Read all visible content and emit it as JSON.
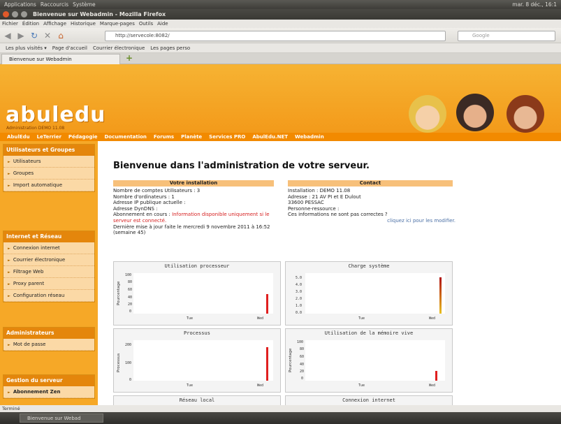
{
  "desktop": {
    "menus": [
      "Applications",
      "Raccourcis",
      "Système"
    ],
    "clock": "mar. 8 déc., 16:1"
  },
  "window": {
    "title": "Bienvenue sur Webadmin - Mozilla Firefox"
  },
  "firefox_menu": [
    "Fichier",
    "Édition",
    "Affichage",
    "Historique",
    "Marque-pages",
    "Outils",
    "Aide"
  ],
  "nav": {
    "url": "http://servecole:8082/",
    "search_placeholder": "Google"
  },
  "bookmarks": [
    "Les plus visités ▾",
    "Page d'accueil",
    "Courrier électronique",
    "Les pages perso"
  ],
  "tab": {
    "label": "Bienvenue sur Webadmin"
  },
  "site": {
    "logo": "abuledu",
    "logo_sub": "Administration DEMO 11.08",
    "top_links": [
      "AbulEdu",
      "LeTerrier",
      "Pédagogie",
      "Documentation",
      "Forums",
      "Planète",
      "Services PRO",
      "AbulEdu.NET",
      "Webadmin"
    ]
  },
  "sidebar": {
    "sections": [
      {
        "title": "Utilisateurs et Groupes",
        "items": [
          "Utilisateurs",
          "Groupes",
          "Import automatique"
        ]
      },
      {
        "title": "Internet et Réseau",
        "items": [
          "Connexion internet",
          "Courrier électronique",
          "Filtrage Web",
          "Proxy parent",
          "Configuration réseau"
        ]
      },
      {
        "title": "Administrateurs",
        "items": [
          "Mot de passe"
        ]
      },
      {
        "title": "Gestion du serveur",
        "items": [
          "Abonnement Zen"
        ]
      }
    ]
  },
  "main": {
    "heading": "Bienvenue dans l'administration de votre serveur.",
    "install": {
      "header": "Votre installation",
      "lines": [
        "Nombre de comptes Utilisateurs : 3",
        "Nombre d'ordinateurs : 1",
        "Adresse IP publique actuelle :",
        "Adresse DynDNS :"
      ],
      "subscription_label": "Abonnement en cours : ",
      "subscription_value": "Information disponible uniquement si le serveur est connecté.",
      "update": "Dernière mise à jour faite le mercredi 9 novembre 2011 à 16:52 (semaine 45)"
    },
    "contact": {
      "header": "Contact",
      "lines": [
        "Installation : DEMO 11.08",
        "Adresse : 21 AV PI et E Dulout",
        "33600 PESSAC",
        "Personne-ressource :",
        "Ces informations ne sont pas correctes ?"
      ],
      "link": "cliquez ici pour les modifier."
    }
  },
  "charts": [
    {
      "title": "Utilisation processeur",
      "ylabel": "Pourcentage",
      "yticks": [
        "100",
        "80",
        "60",
        "40",
        "20",
        "0"
      ],
      "xticks": [
        "Tue",
        "Wed"
      ]
    },
    {
      "title": "Charge système",
      "ylabel": "",
      "yticks": [
        "5.0",
        "4.0",
        "3.0",
        "2.0",
        "1.0",
        "0.0"
      ],
      "xticks": [
        "Tue",
        "Wed"
      ]
    },
    {
      "title": "Processus",
      "ylabel": "Processus",
      "yticks": [
        "200",
        "100",
        "0"
      ],
      "xticks": [
        "Tue",
        "Wed"
      ]
    },
    {
      "title": "Utilisation de la mémoire vive",
      "ylabel": "Pourcentage",
      "yticks": [
        "100",
        "80",
        "60",
        "40",
        "20",
        "0"
      ],
      "xticks": [
        "Tue",
        "Wed"
      ]
    },
    {
      "title": "Réseau local",
      "ylabel": "",
      "yticks": [],
      "xticks": []
    },
    {
      "title": "Connexion internet",
      "ylabel": "",
      "yticks": [],
      "xticks": []
    }
  ],
  "status": "Terminé",
  "taskbar": {
    "item": "Bienvenue sur Webad"
  },
  "colors": {
    "banner": "#f6b333",
    "sidebar": "#f6a827",
    "accent_red": "#e01f1f",
    "link_blue": "#4a6fa5"
  }
}
